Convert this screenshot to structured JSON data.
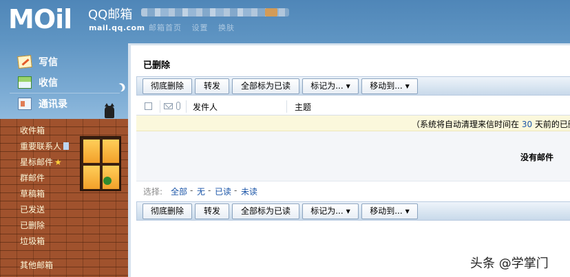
{
  "header": {
    "logo_text": "MOil",
    "brand": "QQ邮箱",
    "domain": "mail.qq.com",
    "top_links": [
      "邮箱首页",
      "设置",
      "换肤"
    ]
  },
  "nav": {
    "compose": "写信",
    "inbox_check": "收信",
    "contacts": "通讯录"
  },
  "folders": [
    {
      "label": "收件箱"
    },
    {
      "label": "重要联系人"
    },
    {
      "label": "星标邮件"
    },
    {
      "label": "群邮件"
    },
    {
      "label": "草稿箱"
    },
    {
      "label": "已发送"
    },
    {
      "label": "已删除"
    },
    {
      "label": "垃圾箱"
    },
    {
      "label": "其他邮箱"
    }
  ],
  "main": {
    "title": "已删除",
    "toolbar": {
      "delete_forever": "彻底删除",
      "forward": "转发",
      "mark_all_read": "全部标为已读",
      "mark_as": "标记为...",
      "move_to": "移动到..."
    },
    "columns": {
      "sender": "发件人",
      "subject": "主题"
    },
    "notice": {
      "prefix": "（系统将自动清理来信时间在 ",
      "days": "30",
      "suffix": " 天前的已删"
    },
    "empty_text": "没有邮件",
    "select": {
      "label": "选择:",
      "all": "全部",
      "none": "无",
      "read": "已读",
      "unread": "未读",
      "separator": "-"
    }
  },
  "watermark": "头条 @学掌门",
  "colors": {
    "link": "#1c56a8",
    "notice_bg": "#fbf8dc",
    "sky": "#5f95c3",
    "brick": "#a0522d"
  }
}
